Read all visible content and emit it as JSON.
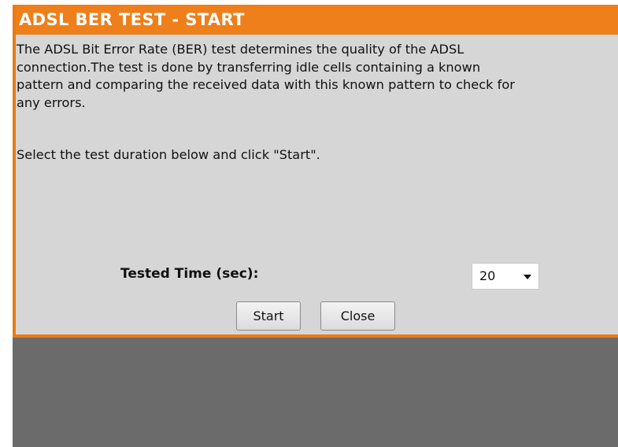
{
  "panel": {
    "title": "ADSL BER TEST - START",
    "description_lines": [
      "The ADSL Bit Error Rate (BER) test determines the quality of the ADSL",
      "connection.The test is done by transferring idle cells containing a known",
      "pattern and comparing the received data with this known pattern to check for",
      "any errors."
    ],
    "instruction": "Select the test duration below and click \"Start\"."
  },
  "form": {
    "tested_time_label": "Tested Time (sec):",
    "tested_time_value": "20"
  },
  "buttons": {
    "start": "Start",
    "close": "Close"
  },
  "colors": {
    "title_bar": "#ee7f1a",
    "panel_bg": "#d6d6d6",
    "backdrop": "#6b6b6b"
  },
  "icons": {
    "dropdown": "chevron-down-icon"
  }
}
